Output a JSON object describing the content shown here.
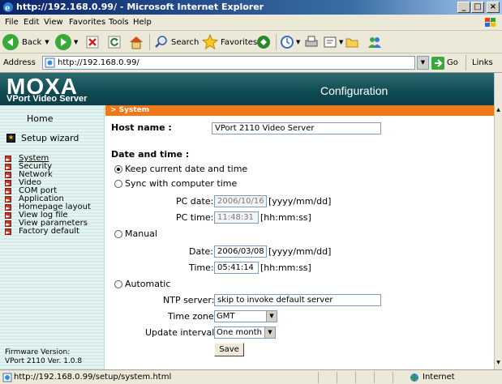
{
  "window": {
    "title": "http://192.168.0.99/ - Microsoft Internet Explorer",
    "controls": [
      "_",
      "□",
      "×"
    ]
  },
  "menu": [
    "File",
    "Edit",
    "View",
    "Favorites",
    "Tools",
    "Help"
  ],
  "toolbar": {
    "back": "Back",
    "search": "Search",
    "favorites": "Favorites"
  },
  "address": {
    "label": "Address",
    "url": "http://192.168.0.99/",
    "go": "Go",
    "links": "Links"
  },
  "header": {
    "logo": "MOXA",
    "subtitle": "VPort Video Server",
    "title": "Configuration"
  },
  "sidebar": {
    "home": "Home",
    "wizard": "Setup wizard",
    "items": [
      {
        "label": "System"
      },
      {
        "label": "Security"
      },
      {
        "label": "Network"
      },
      {
        "label": "Video"
      },
      {
        "label": "COM port"
      },
      {
        "label": "Application"
      },
      {
        "label": "Homepage layout"
      },
      {
        "label": "View log file"
      },
      {
        "label": "View parameters"
      },
      {
        "label": "Factory default"
      }
    ],
    "firmware_label": "Firmware Version:",
    "firmware_value": "VPort 2110 Ver. 1.0.8"
  },
  "section": "> System",
  "form": {
    "host_label": "Host name :",
    "host_value": "VPort 2110 Video Server",
    "dt_label": "Date and time :",
    "opt_keep": "Keep current date and time",
    "opt_sync": "Sync with computer time",
    "pc_date_label": "PC date:",
    "pc_date_value": "2006/10/16",
    "pc_date_fmt": "[yyyy/mm/dd]",
    "pc_time_label": "PC time:",
    "pc_time_value": "11:48:31",
    "pc_time_fmt": "[hh:mm:ss]",
    "opt_manual": "Manual",
    "date_label": "Date:",
    "date_value": "2006/03/08",
    "date_fmt": "[yyyy/mm/dd]",
    "time_label": "Time:",
    "time_value": "05:41:14",
    "time_fmt": "[hh:mm:ss]",
    "opt_auto": "Automatic",
    "ntp_label": "NTP server:",
    "ntp_value": "skip to invoke default server",
    "tz_label": "Time zone:",
    "tz_value": "GMT",
    "interval_label": "Update interval:",
    "interval_value": "One month",
    "save": "Save"
  },
  "status": {
    "url": "http://192.168.0.99/setup/system.html",
    "zone": "Internet"
  }
}
